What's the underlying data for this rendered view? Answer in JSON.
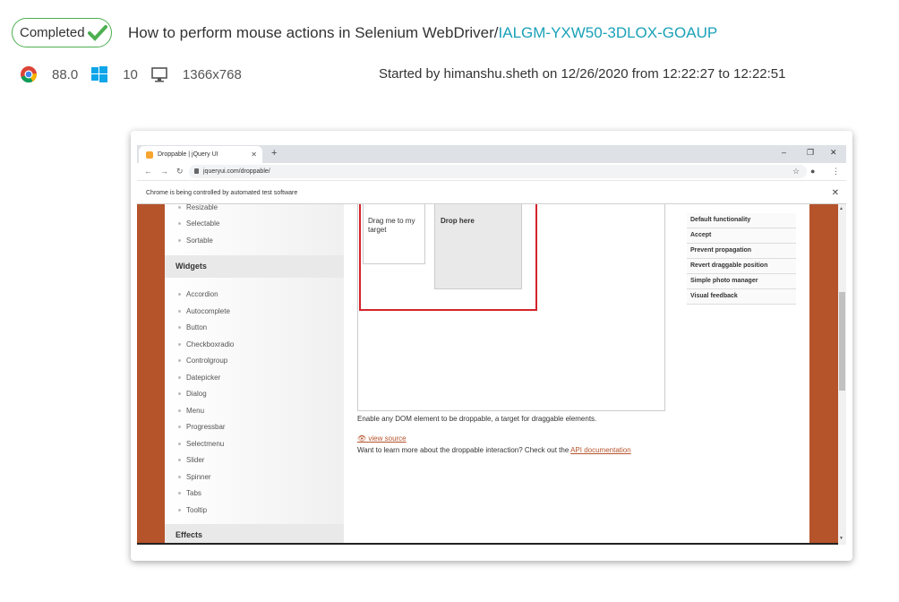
{
  "header": {
    "status": "Completed",
    "title": "How to perform mouse actions in Selenium WebDriver/",
    "test_id": "IALGM-YXW50-3DLOX-GOAUP"
  },
  "meta": {
    "browser_version": "88.0",
    "os_version": "10",
    "resolution": "1366x768",
    "started": "Started by himanshu.sheth on 12/26/2020 from 12:22:27 to 12:22:51"
  },
  "browser": {
    "tab_title": "Droppable | jQuery UI",
    "url": "jqueryui.com/droppable/",
    "infobar": "Chrome is being controlled by automated test software"
  },
  "sidebar": {
    "top_items": [
      "Resizable",
      "Selectable",
      "Sortable"
    ],
    "widgets_heading": "Widgets",
    "widgets": [
      "Accordion",
      "Autocomplete",
      "Button",
      "Checkboxradio",
      "Controlgroup",
      "Datepicker",
      "Dialog",
      "Menu",
      "Progressbar",
      "Selectmenu",
      "Slider",
      "Spinner",
      "Tabs",
      "Tooltip"
    ],
    "effects_heading": "Effects"
  },
  "demo": {
    "drag_text": "Drag me to my target",
    "drop_text": "Drop here",
    "description": "Enable any DOM element to be droppable, a target for draggable elements.",
    "view_source": "view source",
    "learn_more": "Want to learn more about the droppable interaction? Check out the ",
    "api_link": "API documentation"
  },
  "examples": [
    "Default functionality",
    "Accept",
    "Prevent propagation",
    "Revert draggable position",
    "Simple photo manager",
    "Visual feedback"
  ],
  "colors": {
    "accent": "#1aa1b8",
    "brand_orange": "#b5532b",
    "highlight": "#d4232b",
    "success": "#4caf50"
  }
}
